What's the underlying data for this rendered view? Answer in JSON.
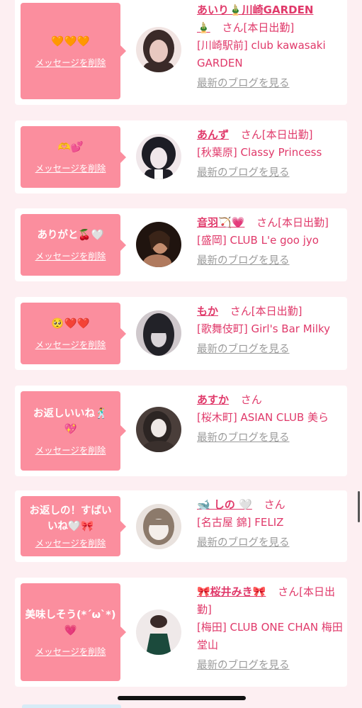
{
  "cards": [
    {
      "message": "🧡🧡🧡",
      "delete_label": "メッセージを削除",
      "name": "あいり🎍川崎GARDEN",
      "line1_extra": "🎍",
      "san": "さん[本日出勤]",
      "shop": "[川崎駅前] club kawasaki GARDEN",
      "blog": "最新のブログを見る",
      "avatar_icon": "woman-portrait",
      "avatar_colors": [
        "#3a2a28",
        "#e8c8c0"
      ]
    },
    {
      "message": "🫶💕",
      "delete_label": "メッセージを削除",
      "name": "あんず",
      "san": "さん[本日出勤]",
      "shop": "[秋葉原] Classy Princess",
      "blog": "最新のブログを見る",
      "avatar_icon": "woman-portrait",
      "avatar_colors": [
        "#1d1d25",
        "#f0e7ea"
      ]
    },
    {
      "message": "ありがと🍒🤍",
      "delete_label": "メッセージを削除",
      "name": "音羽🏹💗",
      "san": "さん[本日出勤]",
      "shop": "[盛岡] CLUB L'e goo jyo",
      "blog": "最新のブログを見る",
      "avatar_icon": "woman-portrait",
      "avatar_colors": [
        "#20140f",
        "#c48d6e"
      ]
    },
    {
      "message": "🥺❤️❤️",
      "delete_label": "メッセージを削除",
      "name": "もか",
      "san": "さん[本日出勤]",
      "shop": "[歌舞伎町] Girl's Bar Milky",
      "blog": "最新のブログを見る",
      "avatar_icon": "woman-portrait",
      "avatar_colors": [
        "#222228",
        "#d9d4d8"
      ]
    },
    {
      "message": "お返しいいね🕺💖",
      "delete_label": "メッセージを削除",
      "name": "あすか",
      "san": "さん",
      "shop": "[桜木町] ASIAN CLUB 美ら",
      "blog": "最新のブログを見る",
      "avatar_icon": "woman-portrait",
      "avatar_colors": [
        "#2c2523",
        "#efe9e6"
      ]
    },
    {
      "message": "お返しの！すばいいね🤍🎀",
      "delete_label": "メッセージを削除",
      "name": "🐋 しの 🤍",
      "san": "さん",
      "shop": "[名古屋 錦] FELIZ",
      "blog": "最新のブログを見る",
      "avatar_icon": "woman-portrait",
      "avatar_colors": [
        "#8c7a6b",
        "#f4eeea"
      ]
    },
    {
      "message": "美味しそう(*´ω`*)💗",
      "delete_label": "メッセージを削除",
      "name": "🎀桜井みき🎀",
      "san": "さん[本日出勤]",
      "shop": "[梅田] CLUB ONE CHAN 梅田堂山",
      "blog": "最新のブログを見る",
      "avatar_icon": "woman-portrait",
      "avatar_colors": [
        "#1b4a3c",
        "#f3e7e4"
      ]
    }
  ]
}
